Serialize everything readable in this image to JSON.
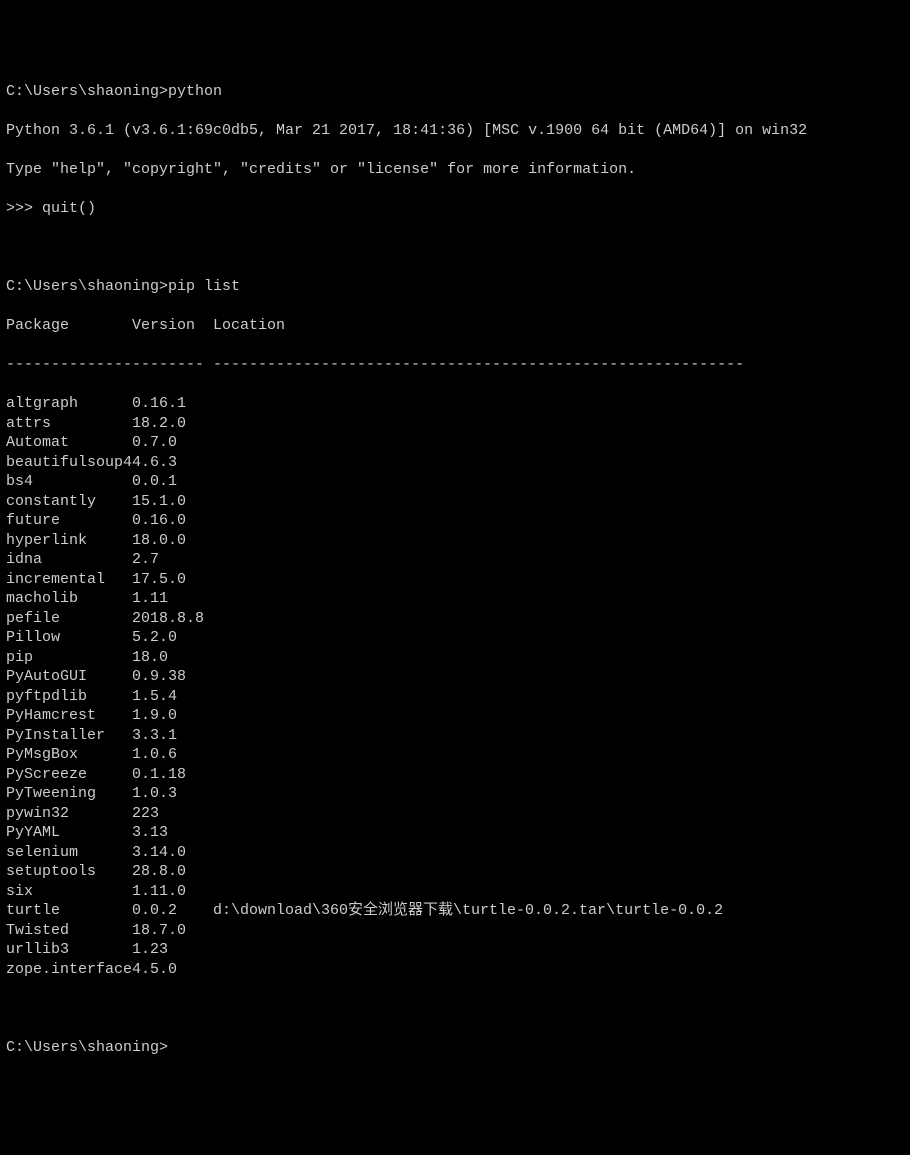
{
  "prompt1": "C:\\Users\\shaoning>",
  "command1": "python",
  "python_banner_line1": "Python 3.6.1 (v3.6.1:69c0db5, Mar 21 2017, 18:41:36) [MSC v.1900 64 bit (AMD64)] on win32",
  "python_banner_line2": "Type \"help\", \"copyright\", \"credits\" or \"license\" for more information.",
  "repl_prompt": ">>> ",
  "repl_command": "quit()",
  "prompt2": "C:\\Users\\shaoning>",
  "command2": "pip list",
  "headers": {
    "package": "Package",
    "version": "Version",
    "location": "Location"
  },
  "divider": {
    "package": "--------------",
    "version": "--------",
    "location": "-----------------------------------------------------------"
  },
  "packages": [
    {
      "name": "altgraph",
      "version": "0.16.1",
      "location": ""
    },
    {
      "name": "attrs",
      "version": "18.2.0",
      "location": ""
    },
    {
      "name": "Automat",
      "version": "0.7.0",
      "location": ""
    },
    {
      "name": "beautifulsoup4",
      "version": "4.6.3",
      "location": ""
    },
    {
      "name": "bs4",
      "version": "0.0.1",
      "location": ""
    },
    {
      "name": "constantly",
      "version": "15.1.0",
      "location": ""
    },
    {
      "name": "future",
      "version": "0.16.0",
      "location": ""
    },
    {
      "name": "hyperlink",
      "version": "18.0.0",
      "location": ""
    },
    {
      "name": "idna",
      "version": "2.7",
      "location": ""
    },
    {
      "name": "incremental",
      "version": "17.5.0",
      "location": ""
    },
    {
      "name": "macholib",
      "version": "1.11",
      "location": ""
    },
    {
      "name": "pefile",
      "version": "2018.8.8",
      "location": ""
    },
    {
      "name": "Pillow",
      "version": "5.2.0",
      "location": ""
    },
    {
      "name": "pip",
      "version": "18.0",
      "location": ""
    },
    {
      "name": "PyAutoGUI",
      "version": "0.9.38",
      "location": ""
    },
    {
      "name": "pyftpdlib",
      "version": "1.5.4",
      "location": ""
    },
    {
      "name": "PyHamcrest",
      "version": "1.9.0",
      "location": ""
    },
    {
      "name": "PyInstaller",
      "version": "3.3.1",
      "location": ""
    },
    {
      "name": "PyMsgBox",
      "version": "1.0.6",
      "location": ""
    },
    {
      "name": "PyScreeze",
      "version": "0.1.18",
      "location": ""
    },
    {
      "name": "PyTweening",
      "version": "1.0.3",
      "location": ""
    },
    {
      "name": "pywin32",
      "version": "223",
      "location": ""
    },
    {
      "name": "PyYAML",
      "version": "3.13",
      "location": ""
    },
    {
      "name": "selenium",
      "version": "3.14.0",
      "location": ""
    },
    {
      "name": "setuptools",
      "version": "28.8.0",
      "location": ""
    },
    {
      "name": "six",
      "version": "1.11.0",
      "location": ""
    },
    {
      "name": "turtle",
      "version": "0.0.2",
      "location": "d:\\download\\360安全浏览器下载\\turtle-0.0.2.tar\\turtle-0.0.2"
    },
    {
      "name": "Twisted",
      "version": "18.7.0",
      "location": ""
    },
    {
      "name": "urllib3",
      "version": "1.23",
      "location": ""
    },
    {
      "name": "zope.interface",
      "version": "4.5.0",
      "location": ""
    }
  ],
  "prompt3": "C:\\Users\\shaoning>"
}
